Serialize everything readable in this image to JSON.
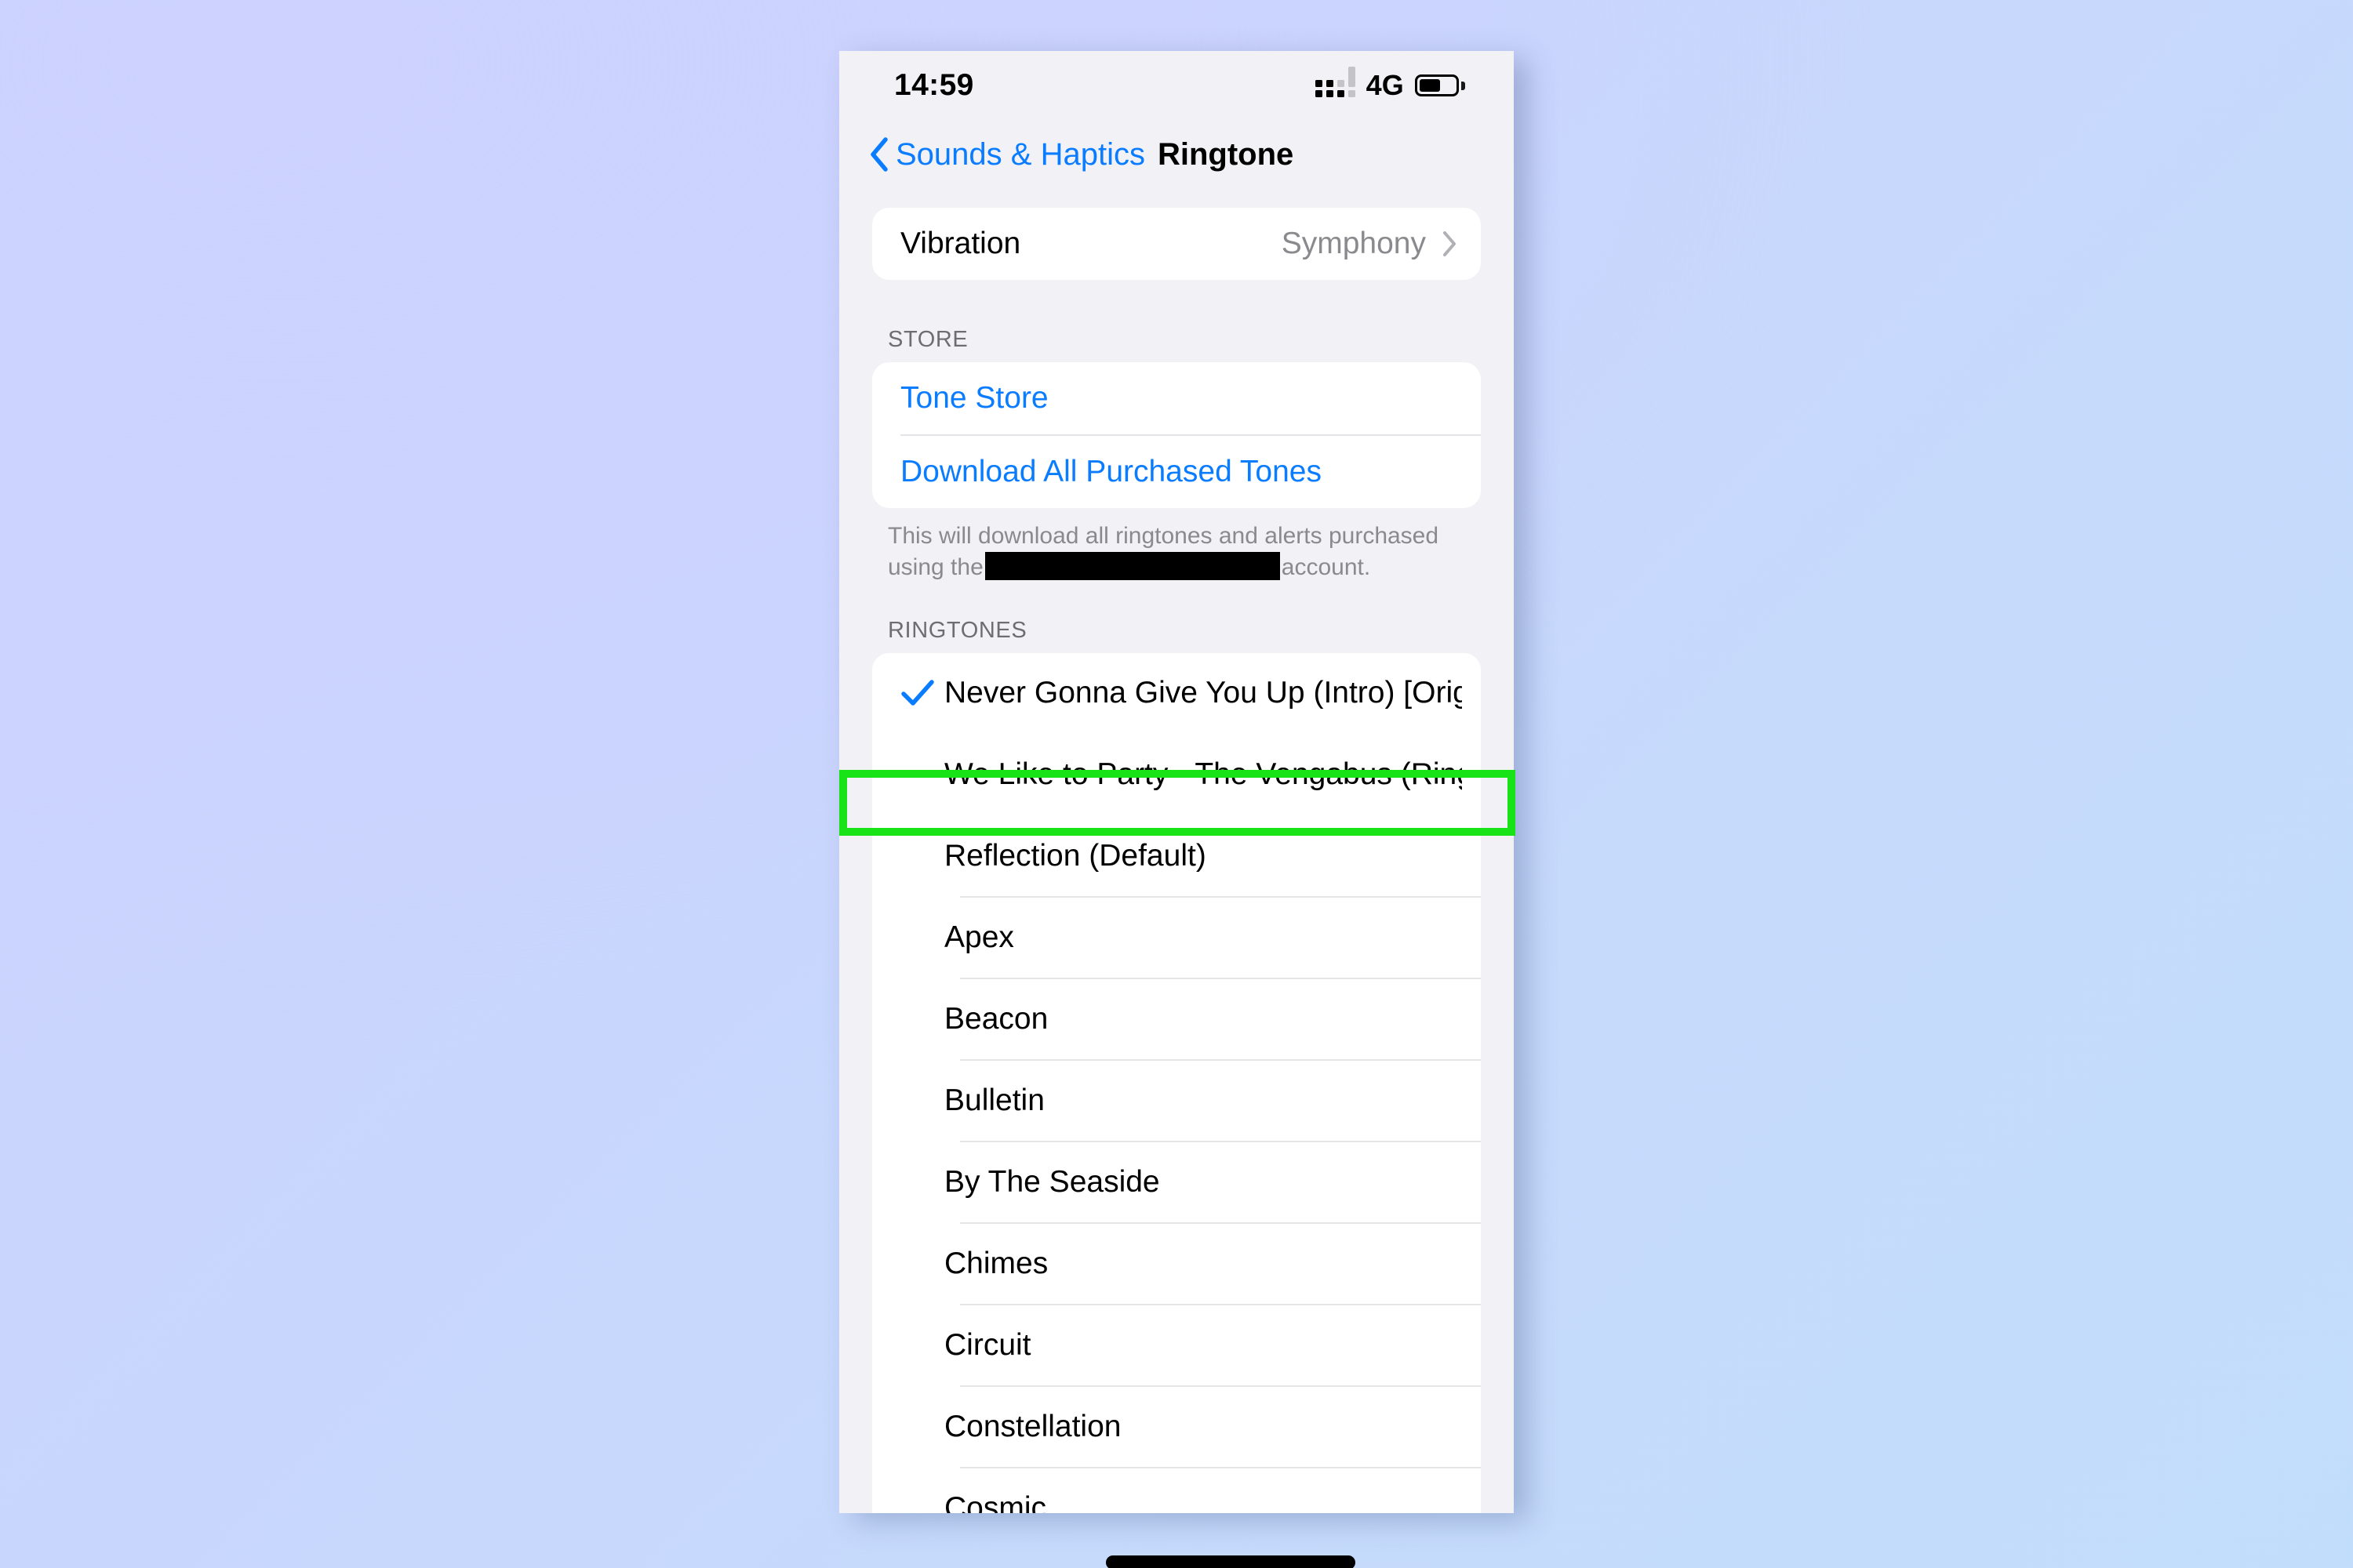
{
  "background": {
    "accent": "#0a7cff",
    "highlight": "#17e317",
    "page_bg": "#f2f2f6"
  },
  "status_bar": {
    "time": "14:59",
    "network": "4G",
    "signal_icon": "signal-bars-icon",
    "battery_icon": "battery-icon"
  },
  "nav": {
    "back_icon": "chevron-left-icon",
    "back_label": "Sounds & Haptics",
    "title": "Ringtone"
  },
  "vibration": {
    "label": "Vibration",
    "value": "Symphony",
    "chevron_icon": "chevron-right-icon"
  },
  "store": {
    "header": "STORE",
    "items": [
      {
        "label": "Tone Store",
        "name": "tone-store"
      },
      {
        "label": "Download All Purchased Tones",
        "name": "download-all-purchased-tones"
      }
    ],
    "footnote_before": "This will download all ringtones and alerts purchased using the",
    "footnote_after": "account.",
    "redacted_icon": "redaction-bar"
  },
  "ringtones": {
    "header": "RINGTONES",
    "items": [
      {
        "label": "Never Gonna Give You Up (Intro) [Origi…",
        "selected": true,
        "highlighted": false
      },
      {
        "label": "We Like to Party - The Vengabus (Ring…",
        "selected": false,
        "highlighted": true
      },
      {
        "label": "Reflection (Default)",
        "selected": false,
        "highlighted": false
      },
      {
        "label": "Apex",
        "selected": false,
        "highlighted": false
      },
      {
        "label": "Beacon",
        "selected": false,
        "highlighted": false
      },
      {
        "label": "Bulletin",
        "selected": false,
        "highlighted": false
      },
      {
        "label": "By The Seaside",
        "selected": false,
        "highlighted": false
      },
      {
        "label": "Chimes",
        "selected": false,
        "highlighted": false
      },
      {
        "label": "Circuit",
        "selected": false,
        "highlighted": false
      },
      {
        "label": "Constellation",
        "selected": false,
        "highlighted": false
      },
      {
        "label": "Cosmic",
        "selected": false,
        "highlighted": false
      }
    ],
    "check_icon": "checkmark-icon"
  },
  "home_indicator": "home-indicator"
}
